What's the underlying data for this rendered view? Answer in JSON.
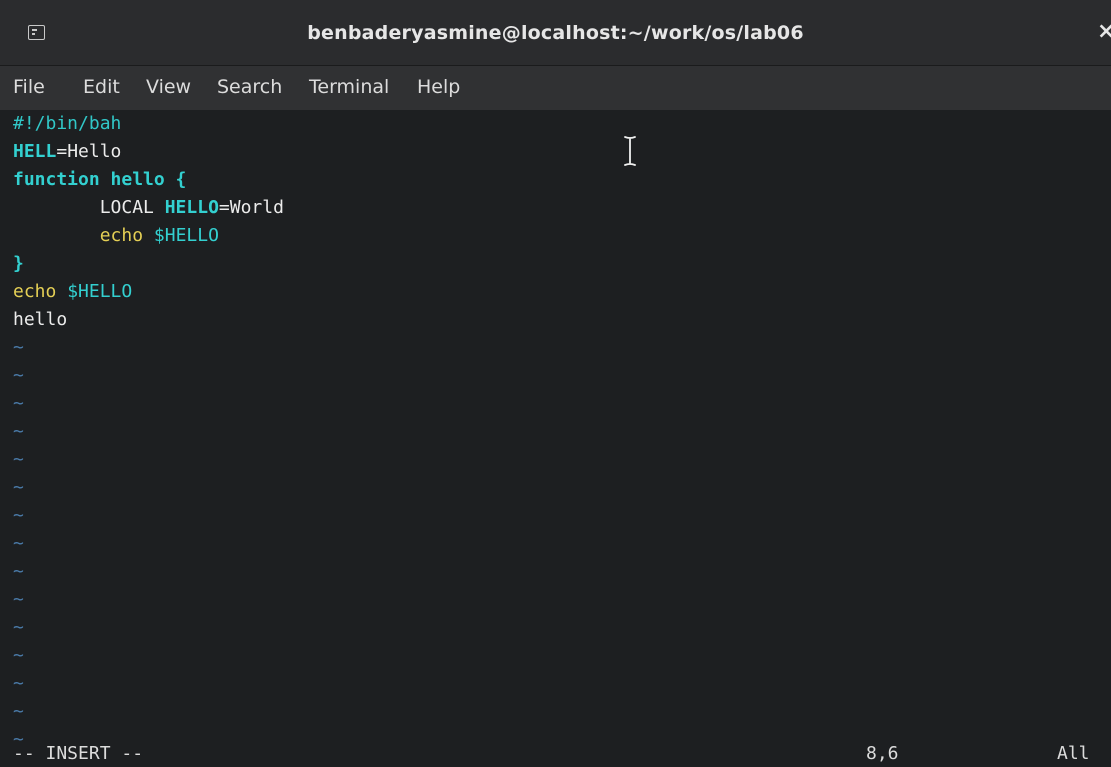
{
  "window": {
    "title": "benbaderyasmine@localhost:~/work/os/lab06",
    "close_glyph": "×"
  },
  "menu": [
    "File",
    "Edit",
    "View",
    "Search",
    "Terminal",
    "Help"
  ],
  "editor": {
    "lines": [
      [
        {
          "t": "#!/bin/bah",
          "c": "c-comment"
        }
      ],
      [
        {
          "t": "HELL",
          "c": "c-var"
        },
        {
          "t": "=Hello",
          "c": "c-plain"
        }
      ],
      [
        {
          "t": "function hello {",
          "c": "c-kw"
        }
      ],
      [
        {
          "t": "        LOCAL ",
          "c": "c-plain"
        },
        {
          "t": "HELLO",
          "c": "c-var"
        },
        {
          "t": "=World",
          "c": "c-plain"
        }
      ],
      [
        {
          "t": "        echo ",
          "c": "c-echo"
        },
        {
          "t": "$HELLO",
          "c": "c-dollar"
        }
      ],
      [
        {
          "t": "}",
          "c": "c-kw"
        }
      ],
      [
        {
          "t": "echo ",
          "c": "c-echo"
        },
        {
          "t": "$HELLO",
          "c": "c-dollar"
        }
      ],
      [
        {
          "t": "hello",
          "c": "c-plain"
        }
      ]
    ],
    "tilde_char": "~",
    "tilde_count": 15
  },
  "status": {
    "mode": "-- INSERT --",
    "position": "8,6",
    "scroll": "All"
  },
  "colors": {
    "background": "#1d1f21",
    "comment": "#31c7c7",
    "keyword": "#33d0d0",
    "echo": "#e4cf55",
    "tilde": "#4a7aa8"
  }
}
